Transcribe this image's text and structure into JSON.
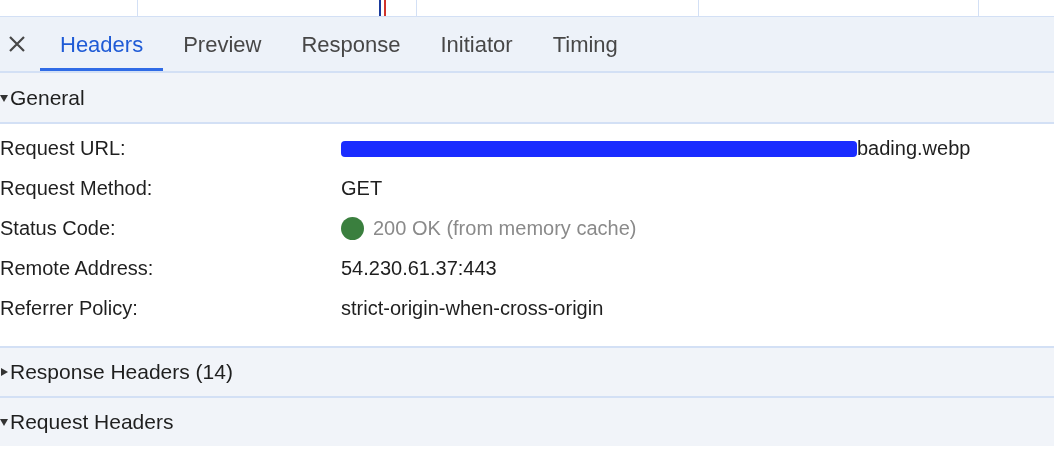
{
  "tabs": [
    {
      "label": "Headers",
      "selected": true
    },
    {
      "label": "Preview",
      "selected": false
    },
    {
      "label": "Response",
      "selected": false
    },
    {
      "label": "Initiator",
      "selected": false
    },
    {
      "label": "Timing",
      "selected": false
    }
  ],
  "sections": [
    {
      "title": "General",
      "expanded": true,
      "rows": [
        {
          "label": "Request URL:",
          "kind": "redacted",
          "value": "bading.webp"
        },
        {
          "label": "Request Method:",
          "kind": "text",
          "value": "GET"
        },
        {
          "label": "Status Code:",
          "kind": "status",
          "value": "200 OK (from memory cache)"
        },
        {
          "label": "Remote Address:",
          "kind": "text",
          "value": "54.230.61.37:443"
        },
        {
          "label": "Referrer Policy:",
          "kind": "text",
          "value": "strict-origin-when-cross-origin"
        }
      ]
    },
    {
      "title": "Response Headers (14)",
      "expanded": false
    },
    {
      "title": "Request Headers",
      "expanded": true
    }
  ]
}
